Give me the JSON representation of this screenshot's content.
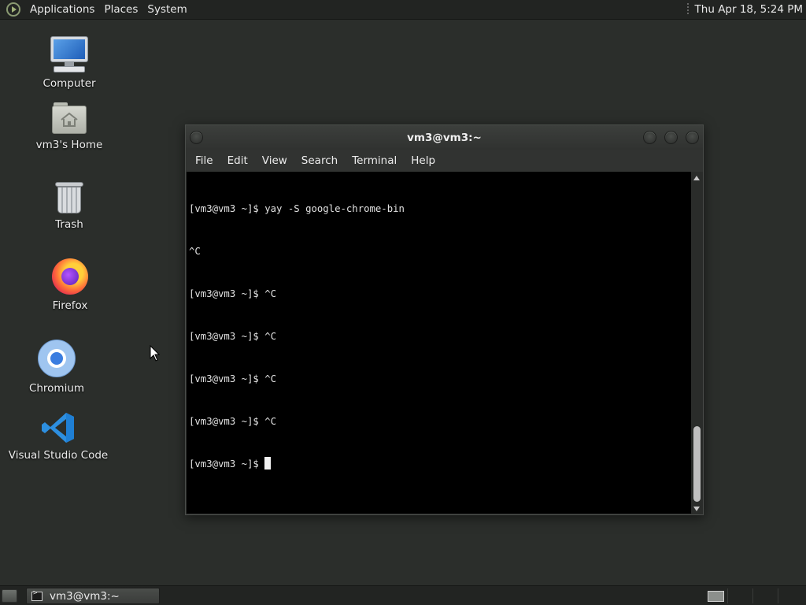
{
  "top_panel": {
    "menus": [
      "Applications",
      "Places",
      "System"
    ],
    "clock": "Thu Apr 18,  5:24 PM"
  },
  "desktop": {
    "icons": [
      {
        "label": "Computer",
        "icon": "computer-icon"
      },
      {
        "label": "vm3's Home",
        "icon": "home-folder-icon"
      },
      {
        "label": "Trash",
        "icon": "trash-icon"
      },
      {
        "label": "Firefox",
        "icon": "firefox-icon"
      },
      {
        "label": "Chromium",
        "icon": "chromium-icon"
      },
      {
        "label": "Visual Studio Code",
        "icon": "vscode-icon"
      }
    ]
  },
  "terminal": {
    "title": "vm3@vm3:~",
    "menu": [
      "File",
      "Edit",
      "View",
      "Search",
      "Terminal",
      "Help"
    ],
    "lines": [
      "[vm3@vm3 ~]$ yay -S google-chrome-bin",
      "^C",
      "[vm3@vm3 ~]$ ^C",
      "[vm3@vm3 ~]$ ^C",
      "[vm3@vm3 ~]$ ^C",
      "[vm3@vm3 ~]$ ^C",
      "[vm3@vm3 ~]$ "
    ]
  },
  "taskbar": {
    "window_button": "vm3@vm3:~"
  },
  "colors": {
    "desktop_bg": "#2b2e2b",
    "panel_bg": "#222422",
    "terminal_bg": "#000000",
    "terminal_fg": "#e2e2e2",
    "vscode_blue": "#2d8fe0"
  }
}
